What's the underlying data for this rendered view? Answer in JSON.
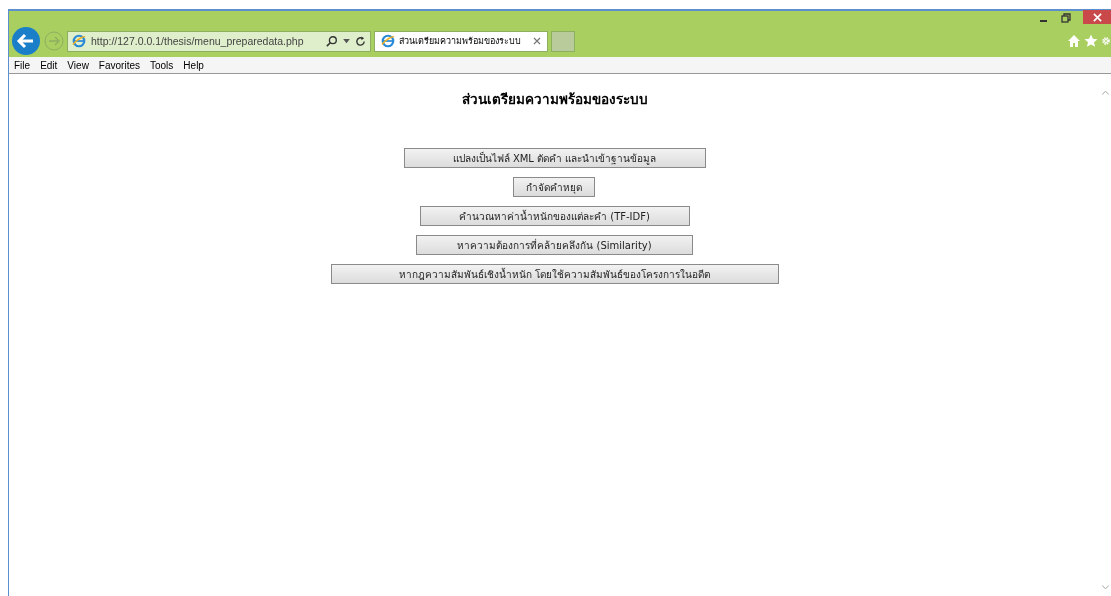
{
  "browser": {
    "address": "http://127.0.0.1/thesis/menu_preparedata.php",
    "tabs": [
      {
        "title": "ส่วนเตรียมความพร้อมของระบบ",
        "selected": true
      }
    ],
    "menu": [
      "File",
      "Edit",
      "View",
      "Favorites",
      "Tools",
      "Help"
    ]
  },
  "page": {
    "heading": "ส่วนเตรียมความพร้อมของระบบ",
    "buttons": [
      "แปลงเป็นไฟล์ XML ตัดคำ และนำเข้าฐานข้อมูล",
      "กำจัดคำหยุด",
      "คำนวณหาค่าน้ำหนักของแต่ละคำ (TF-IDF)",
      "หาความต้องการที่คล้ายคลึงกัน (Similarity)",
      "หากฎความสัมพันธ์เชิงน้ำหนัก โดยใช้ความสัมพันธ์ของโครงการในอดีต"
    ]
  }
}
